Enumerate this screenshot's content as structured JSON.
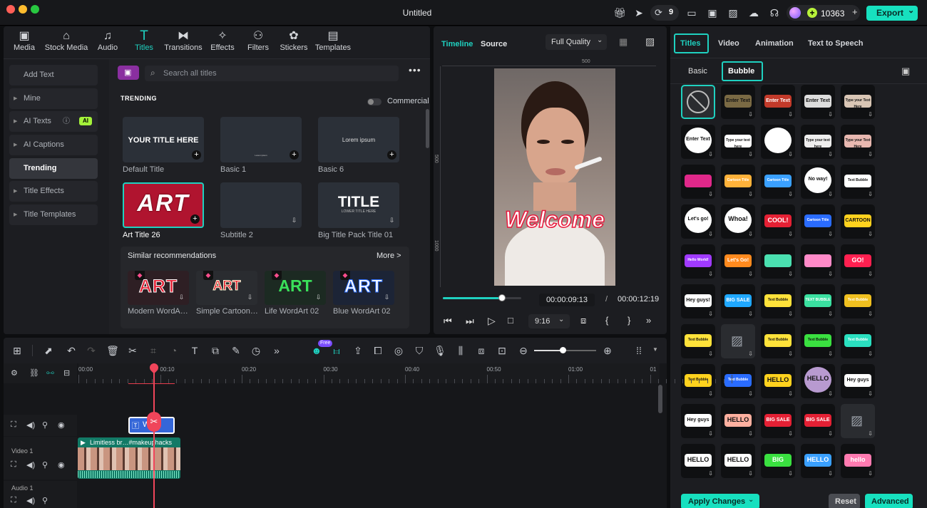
{
  "window": {
    "title": "Untitled",
    "credits": "10363",
    "export_label": "Export",
    "chevron": "⌄",
    "notif_count": "9"
  },
  "media_tabs": [
    {
      "label": "Media",
      "icon": "media-icon"
    },
    {
      "label": "Stock Media",
      "icon": "stock-media-icon"
    },
    {
      "label": "Audio",
      "icon": "audio-icon"
    },
    {
      "label": "Titles",
      "icon": "titles-icon"
    },
    {
      "label": "Transitions",
      "icon": "transitions-icon"
    },
    {
      "label": "Effects",
      "icon": "effects-icon"
    },
    {
      "label": "Filters",
      "icon": "filters-icon"
    },
    {
      "label": "Stickers",
      "icon": "stickers-icon"
    },
    {
      "label": "Templates",
      "icon": "templates-icon"
    }
  ],
  "sidebar": {
    "items": [
      "Add Text",
      "Mine",
      "AI Texts",
      "AI Captions",
      "Trending",
      "Title Effects",
      "Title Templates"
    ],
    "ai_badge": "AI"
  },
  "search": {
    "placeholder": "Search all titles"
  },
  "trending": {
    "heading": "TRENDING",
    "commercial": "Commercial",
    "cards": [
      {
        "label": "Default Title",
        "thumb_text": "YOUR TITLE HERE"
      },
      {
        "label": "Basic 1",
        "thumb_text": "Lorem ipsum"
      },
      {
        "label": "Basic 6",
        "thumb_text": "Lorem ipsum"
      },
      {
        "label": "Art Title 26",
        "thumb_text": "ART"
      },
      {
        "label": "Subtitle 2",
        "thumb_text": ""
      },
      {
        "label": "Big Title Pack Title 01",
        "thumb_text": "TITLE",
        "sub": "LOWER TITLE HERE"
      }
    ]
  },
  "similar": {
    "heading": "Similar recommendations",
    "more": "More >",
    "items": [
      {
        "label": "Modern WordA…",
        "art": "ART"
      },
      {
        "label": "Simple Cartoon…",
        "art": "ART"
      },
      {
        "label": "Life WordArt 02",
        "art": "ART"
      },
      {
        "label": "Blue WordArt 02",
        "art": "ART"
      }
    ]
  },
  "preview": {
    "tab_timeline": "Timeline",
    "tab_source": "Source",
    "quality": "Full Quality",
    "ruler_500": "500",
    "ruler_v500": "500",
    "ruler_v1000": "1000",
    "overlay_text": "Welcome",
    "current_time": "00:00:09:13",
    "separator": "/",
    "total_time": "00:00:12:19",
    "ratio": "9:16",
    "progress": 0.25
  },
  "right_panel": {
    "tabs": [
      "Titles",
      "Video",
      "Animation",
      "Text to Speech"
    ],
    "subtabs": [
      "Basic",
      "Bubble"
    ],
    "apply": "Apply Changes",
    "reset": "Reset",
    "advanced": "Advanced",
    "tiles": [
      "",
      "Enter Text",
      "Enter Text",
      "Enter Text",
      "Type your Text Here",
      "Enter Text",
      "Type your text here",
      "",
      "Type your text here",
      "Type your Text Here",
      "",
      "Cartoon Title",
      "Cartoon Title",
      "No way!",
      "Text Bubble",
      "Let's go!",
      "Whoa!",
      "COOL!",
      "Cartoon Title",
      "CARTOON",
      "Hello World!",
      "Let's Go!",
      "",
      "",
      "GO!",
      "Hey guys!",
      "BIG SALE",
      "Text Bubble",
      "TEXT BUBBLE",
      "Text Bubble",
      "Text Bubble",
      "",
      "Text Bubble",
      "Text Bubble",
      "Text Bubble",
      "Text Bubble",
      "Text Bubble",
      "HELLO",
      "HELLO",
      "Hey guys",
      "Hey guys",
      "HELLO",
      "BIG SALE",
      "BIG SALE",
      "",
      "HELLO",
      "HELLO",
      "BIG",
      "HELLO",
      "hello"
    ]
  },
  "timeline": {
    "ruler": [
      "00:00",
      "00:10",
      "00:20",
      "00:30",
      "00:40",
      "00:50",
      "01:00",
      "01"
    ],
    "video_track": "Video 1",
    "audio_track": "Audio 1",
    "clip_label": "Limitless br…#makeuphacks",
    "title_clip": "W",
    "free_badge": "Free"
  }
}
